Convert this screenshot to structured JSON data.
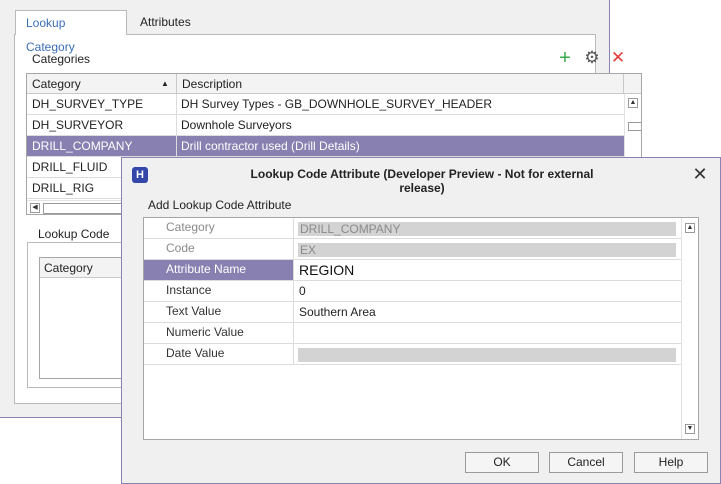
{
  "bg_window": {
    "tabs": [
      {
        "label": "Lookup Category"
      },
      {
        "label": "Attributes"
      }
    ],
    "categories_label": "Categories",
    "icons": {
      "add": "add-icon",
      "settings": "gear-icon",
      "delete": "delete-icon"
    },
    "grid": {
      "headers": [
        "Category",
        "Description"
      ],
      "rows": [
        {
          "category": "DH_SURVEY_TYPE",
          "description": "DH Survey Types - GB_DOWNHOLE_SURVEY_HEADER"
        },
        {
          "category": "DH_SURVEYOR",
          "description": "Downhole Surveyors"
        },
        {
          "category": "DRILL_COMPANY",
          "description": "Drill contractor used (Drill Details)",
          "selected": true
        },
        {
          "category": "DRILL_FLUID",
          "description": ""
        },
        {
          "category": "DRILL_RIG",
          "description": ""
        }
      ]
    },
    "lookup_code_label": "Lookup Code",
    "lookup_code_grid_header": "Category"
  },
  "dialog": {
    "title": "Lookup Code Attribute (Developer Preview - Not for external release)",
    "logo": "H",
    "close": "✕",
    "subtitle": "Add Lookup Code Attribute",
    "fields": [
      {
        "label": "Category",
        "value": "DRILL_COMPANY",
        "readonly": true
      },
      {
        "label": "Code",
        "value": "EX",
        "readonly": true
      },
      {
        "label": "Attribute Name",
        "value": "REGION",
        "selected": true
      },
      {
        "label": "Instance",
        "value": "0"
      },
      {
        "label": "Text Value",
        "value": "Southern Area"
      },
      {
        "label": "Numeric Value",
        "value": ""
      },
      {
        "label": "Date Value",
        "value": "",
        "readonly": true
      }
    ],
    "buttons": {
      "ok": "OK",
      "cancel": "Cancel",
      "help": "Help"
    }
  },
  "colors": {
    "selection": "#8880b0",
    "accent_tab": "#3b6fb6",
    "add_green": "#3aa84a",
    "delete_red": "#e03c3c",
    "window_border": "#8a82b3"
  }
}
